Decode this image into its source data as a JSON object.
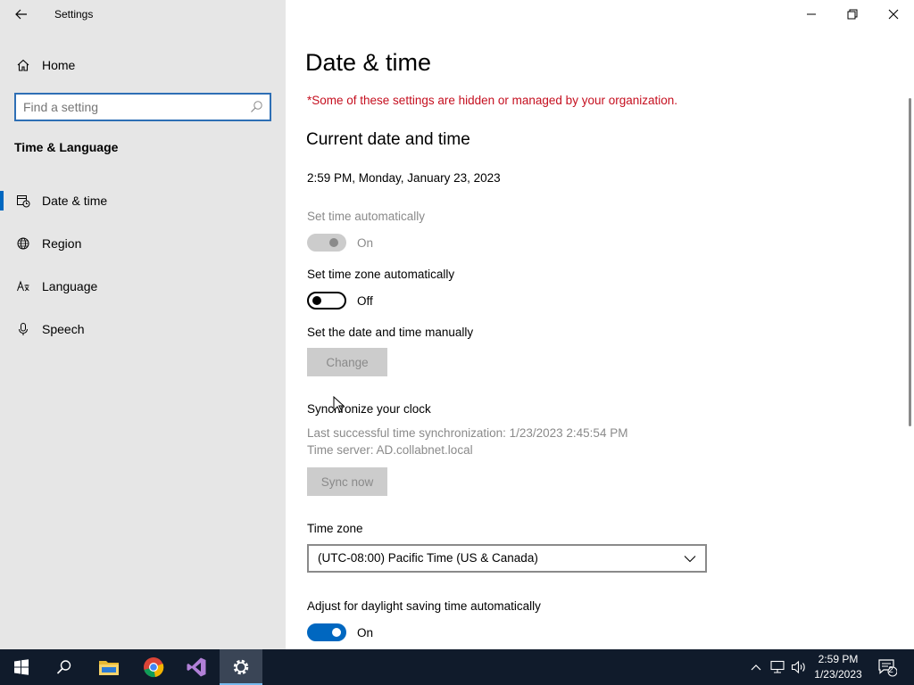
{
  "app": {
    "title": "Settings"
  },
  "sidebar": {
    "home_label": "Home",
    "search_placeholder": "Find a setting",
    "section_title": "Time & Language",
    "items": [
      {
        "label": "Date & time",
        "icon": "date-time-icon",
        "selected": true
      },
      {
        "label": "Region",
        "icon": "globe-icon",
        "selected": false
      },
      {
        "label": "Language",
        "icon": "language-icon",
        "selected": false
      },
      {
        "label": "Speech",
        "icon": "microphone-icon",
        "selected": false
      }
    ]
  },
  "main": {
    "title": "Date & time",
    "managed_notice": "*Some of these settings are hidden or managed by your organization.",
    "current_heading": "Current date and time",
    "current_datetime": "2:59 PM, Monday, January 23, 2023",
    "set_time_auto": {
      "label": "Set time automatically",
      "state": "On",
      "enabled": false
    },
    "set_tz_auto": {
      "label": "Set time zone automatically",
      "state": "Off",
      "enabled": true
    },
    "manual": {
      "label": "Set the date and time manually",
      "button": "Change"
    },
    "sync": {
      "heading": "Synchronize your clock",
      "last_sync": "Last successful time synchronization: 1/23/2023 2:45:54 PM",
      "server": "Time server: AD.collabnet.local",
      "button": "Sync now"
    },
    "timezone": {
      "label": "Time zone",
      "value": "(UTC-08:00) Pacific Time (US & Canada)"
    },
    "dst": {
      "label": "Adjust for daylight saving time automatically",
      "state": "On"
    }
  },
  "taskbar": {
    "time": "2:59 PM",
    "date": "1/23/2023",
    "notification_count": "2",
    "apps": [
      "start-icon",
      "search-icon",
      "file-explorer-icon",
      "chrome-icon",
      "visual-studio-icon",
      "settings-icon"
    ]
  },
  "colors": {
    "accent": "#0067c0",
    "warning": "#c50f1f",
    "taskbar": "#101b2b",
    "sidebar": "#e6e6e6"
  }
}
